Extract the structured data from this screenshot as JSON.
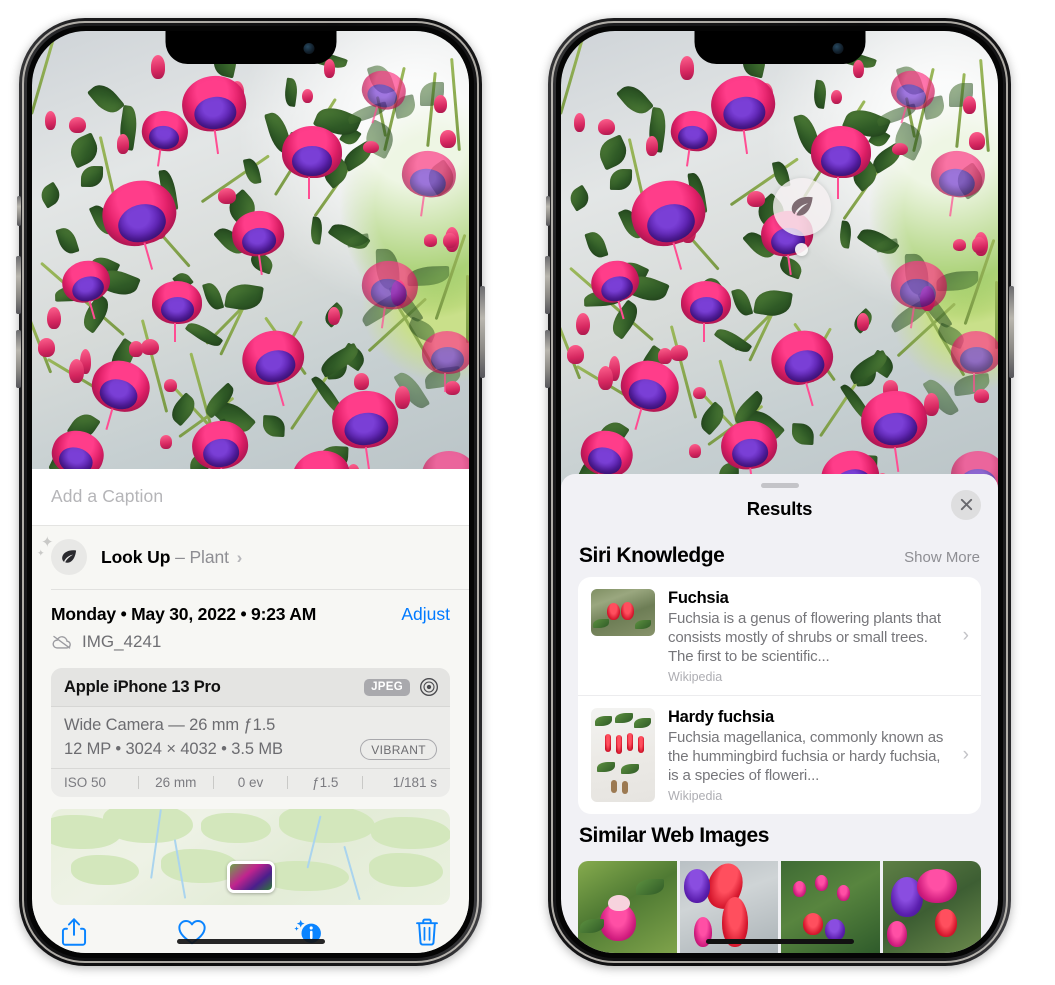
{
  "left_phone": {
    "screen_name": "photos-info-screen",
    "caption": {
      "placeholder": "Add a Caption",
      "value": ""
    },
    "look_up": {
      "icon": "leaf-icon",
      "sparkle_icon": "sparkles-icon",
      "label": "Look Up",
      "separator": "–",
      "subject": "Plant",
      "chevron": "›"
    },
    "date_row": {
      "date": "Monday • May 30, 2022 • 9:23 AM",
      "adjust_label": "Adjust"
    },
    "file_row": {
      "icon": "icloud-slash-icon",
      "filename": "IMG_4241"
    },
    "exif": {
      "device": "Apple iPhone 13 Pro",
      "format_badge": "JPEG",
      "aperture_icon": "aperture-icon",
      "lens_line": "Wide Camera — 26 mm ƒ1.5",
      "detail_line": "12 MP • 3024 × 4032 • 3.5 MB",
      "style_badge": "VIBRANT",
      "stats": [
        "ISO 50",
        "26 mm",
        "0 ev",
        "ƒ1.5",
        "1/181 s"
      ]
    },
    "map": {
      "name": "location-map",
      "pin": "photo-thumbnail-pin"
    },
    "toolbar": [
      {
        "name": "share-button",
        "icon": "share-icon"
      },
      {
        "name": "favorite-button",
        "icon": "heart-icon"
      },
      {
        "name": "info-button",
        "icon": "info-sparkle-icon"
      },
      {
        "name": "delete-button",
        "icon": "trash-icon"
      }
    ],
    "accent_color": "#007aff"
  },
  "right_phone": {
    "screen_name": "visual-look-up-results-screen",
    "photo_badge": {
      "icon": "leaf-icon",
      "name": "visual-look-up-badge"
    },
    "sheet": {
      "grabber": "sheet-grabber",
      "title": "Results",
      "close_icon": "close-icon"
    },
    "siri_knowledge": {
      "title": "Siri Knowledge",
      "show_more": "Show More",
      "results": [
        {
          "title": "Fuchsia",
          "description": "Fuchsia is a genus of flowering plants that consists mostly of shrubs or small trees. The first to be scientific...",
          "source": "Wikipedia",
          "chevron": "›"
        },
        {
          "title": "Hardy fuchsia",
          "description": "Fuchsia magellanica, commonly known as the hummingbird fuchsia or hardy fuchsia, is a species of floweri...",
          "source": "Wikipedia",
          "chevron": "›"
        }
      ]
    },
    "similar_web_images": {
      "title": "Similar Web Images",
      "thumbnails": [
        "fuchsia-pink-white-bloom",
        "fuchsia-red-magenta-closeup",
        "fuchsia-shrub-with-buds",
        "fuchsia-purple-double-bloom"
      ]
    }
  }
}
